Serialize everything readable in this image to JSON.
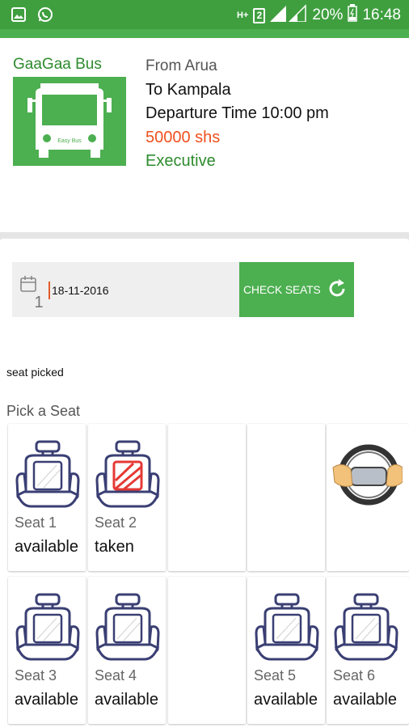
{
  "status_bar": {
    "network": "H+",
    "sim": "2",
    "battery": "20%",
    "time": "16:48"
  },
  "bus": {
    "name": "GaaGaa Bus",
    "image_caption": "Easy Bus",
    "from": "From Arua",
    "to": "To Kampala",
    "departure": "Departure Time 10:00 pm",
    "price": "50000 shs",
    "class": "Executive"
  },
  "date": {
    "icon_digit": "1",
    "value": "18-11-2016",
    "button_label": "CHECK SEATS"
  },
  "seat_picked_text": "seat picked",
  "pick_title": "Pick a Seat",
  "seats": [
    {
      "label": "Seat 1",
      "status": "available"
    },
    {
      "label": "Seat 2",
      "status": "taken"
    },
    {
      "label": "Seat 3",
      "status": "available"
    },
    {
      "label": "Seat 4",
      "status": "available"
    },
    {
      "label": "Seat 5",
      "status": "available"
    },
    {
      "label": "Seat 6",
      "status": "available"
    }
  ],
  "colors": {
    "primary_green": "#4caf50",
    "status_bar_green": "#3f9f3f",
    "price_orange": "#f0501e",
    "seat_outline": "#3a3f73",
    "taken_red": "#e53935"
  },
  "icons": [
    "image-icon",
    "whatsapp-icon",
    "signal-icon",
    "battery-icon",
    "bus-icon",
    "calendar-icon",
    "refresh-icon",
    "seat-icon",
    "steering-wheel-icon"
  ]
}
